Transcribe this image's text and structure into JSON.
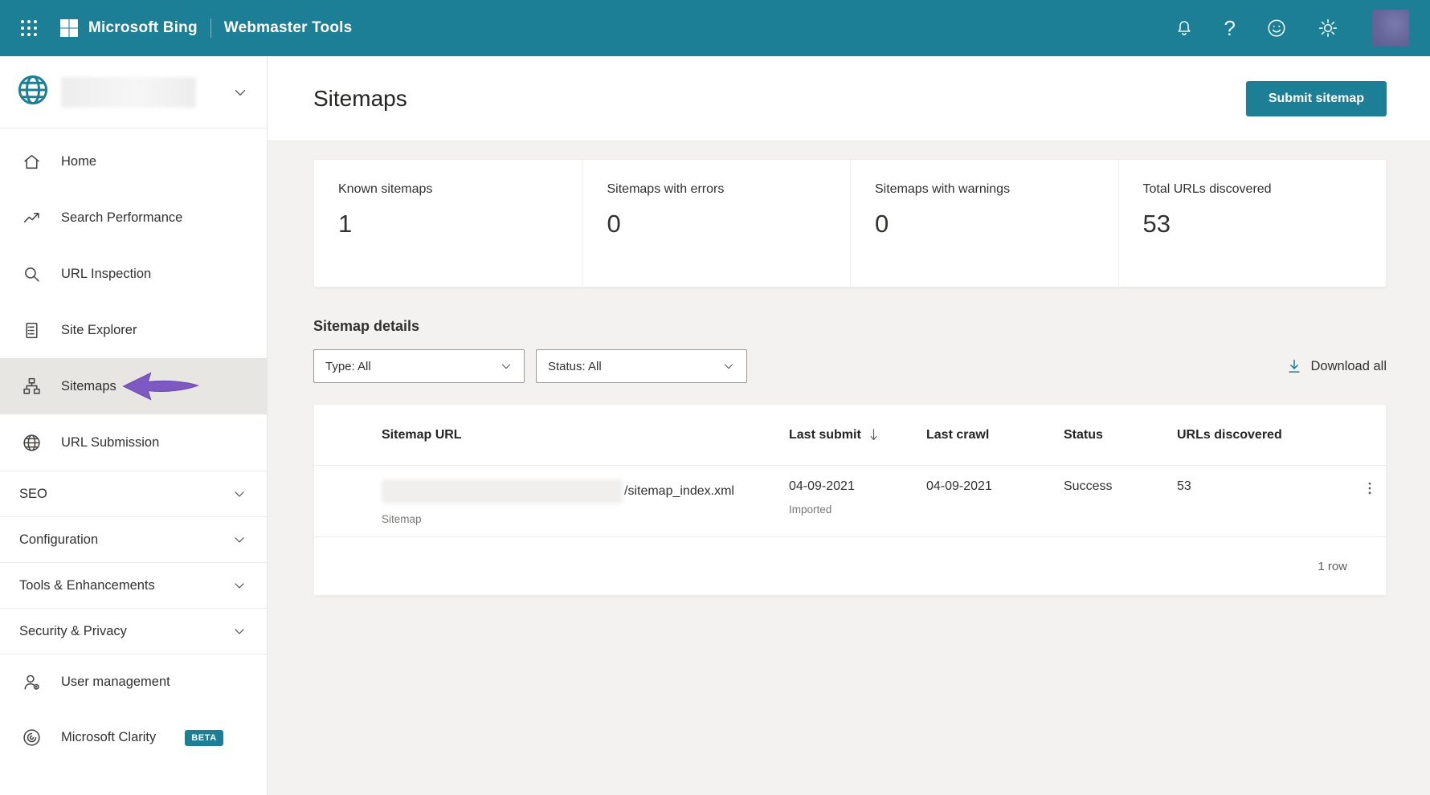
{
  "colors": {
    "accent": "#1d7f96",
    "arrow_purple": "#7d59c1",
    "active_item_bg": "#e8e6e3"
  },
  "header": {
    "brand": "Microsoft Bing",
    "product": "Webmaster Tools",
    "help_glyph": "?"
  },
  "sidebar": {
    "items": [
      {
        "label": "Home",
        "icon": "home-icon"
      },
      {
        "label": "Search Performance",
        "icon": "trending-up-icon"
      },
      {
        "label": "URL Inspection",
        "icon": "magnifier-icon"
      },
      {
        "label": "Site Explorer",
        "icon": "document-icon"
      },
      {
        "label": "Sitemaps",
        "icon": "sitemap-icon",
        "active": true
      },
      {
        "label": "URL Submission",
        "icon": "globe-icon"
      }
    ],
    "groups": [
      {
        "label": "SEO"
      },
      {
        "label": "Configuration"
      },
      {
        "label": "Tools & Enhancements"
      },
      {
        "label": "Security & Privacy"
      }
    ],
    "footer_items": [
      {
        "label": "User management",
        "icon": "user-icon"
      },
      {
        "label": "Microsoft Clarity",
        "icon": "clarity-icon",
        "badge": "BETA"
      }
    ]
  },
  "page": {
    "title": "Sitemaps",
    "submit_button": "Submit sitemap"
  },
  "stats": [
    {
      "label": "Known sitemaps",
      "value": "1"
    },
    {
      "label": "Sitemaps with errors",
      "value": "0"
    },
    {
      "label": "Sitemaps with warnings",
      "value": "0"
    },
    {
      "label": "Total URLs discovered",
      "value": "53"
    }
  ],
  "details": {
    "heading": "Sitemap details",
    "type_filter": "Type: All",
    "status_filter": "Status: All",
    "download_label": "Download all"
  },
  "table": {
    "columns": [
      "Sitemap URL",
      "Last submit",
      "Last crawl",
      "Status",
      "URLs discovered"
    ],
    "rows": [
      {
        "url_path": "/sitemap_index.xml",
        "url_type": "Sitemap",
        "last_submit": "04-09-2021",
        "submit_note": "Imported",
        "last_crawl": "04-09-2021",
        "status": "Success",
        "urls_discovered": "53"
      }
    ],
    "footer": "1 row"
  }
}
